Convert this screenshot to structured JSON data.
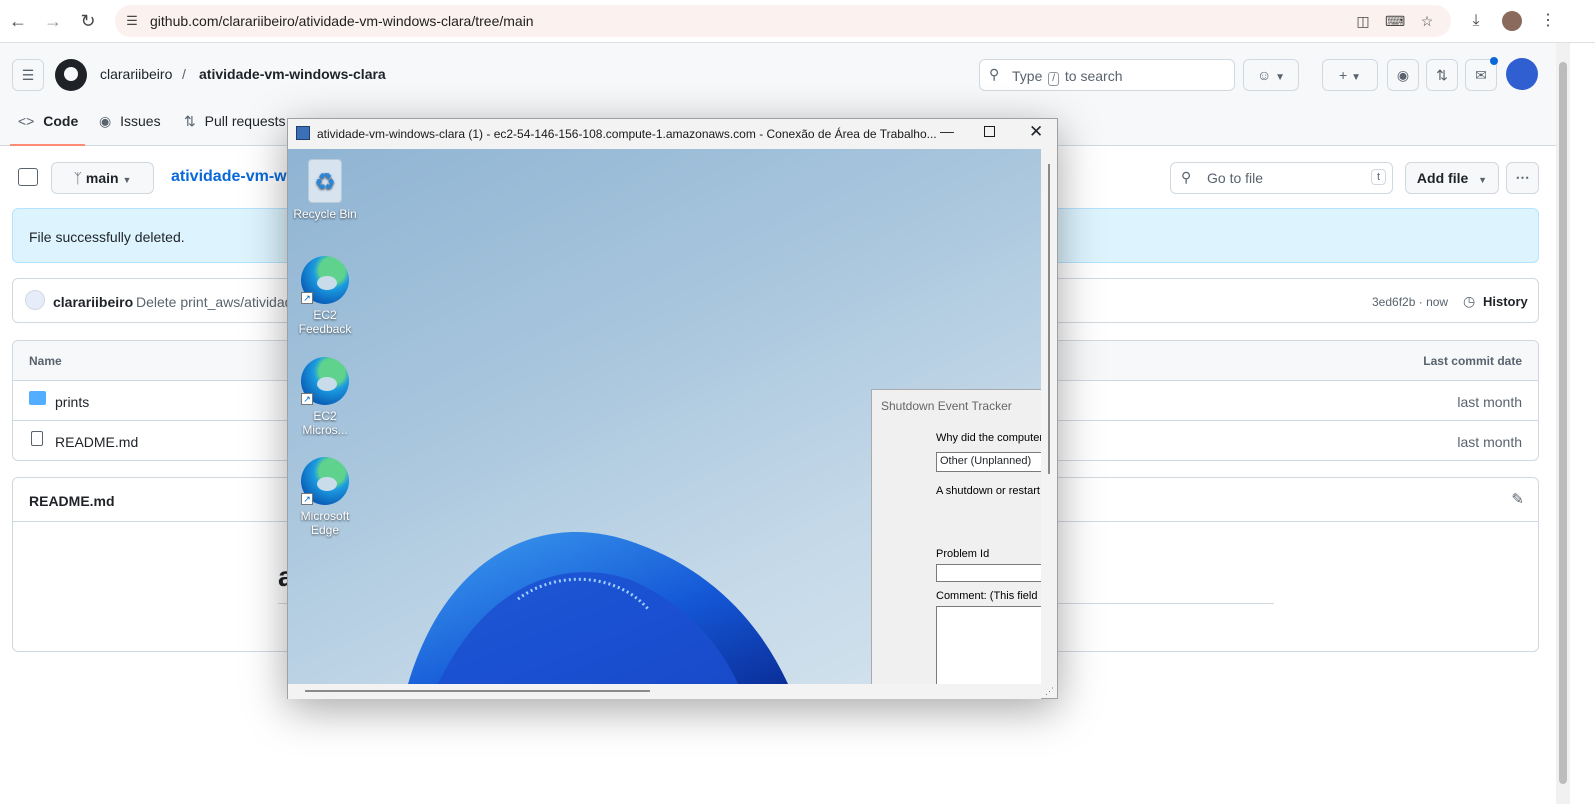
{
  "browser": {
    "url": "github.com/clarariibeiro/atividade-vm-windows-clara/tree/main",
    "icons": [
      "back-icon",
      "forward-icon",
      "reload-icon",
      "site-info-icon",
      "install-app-icon",
      "translate-icon",
      "bookmark-star-icon",
      "download-icon",
      "profile-avatar",
      "menu-kebab-icon"
    ]
  },
  "github": {
    "owner": "clarariibeiro",
    "separator": "/",
    "repo": "atividade-vm-windows-clara",
    "search": {
      "before": "Type",
      "key": "/",
      "after": "to search"
    },
    "tabs": [
      {
        "label": "Code"
      },
      {
        "label": "Issues"
      },
      {
        "label": "Pull requests"
      }
    ],
    "branch": "main",
    "breadcrumb_repo": "atividade-vm-wi",
    "goto_file": {
      "placeholder": "Go to file",
      "shortcut": "t"
    },
    "add_file": "Add file",
    "flash_message": "File successfully deleted.",
    "commit": {
      "author": "clarariibeiro",
      "message": "Delete print_aws/atividad",
      "sha": "3ed6f2b",
      "time": "now",
      "history_label": "History"
    },
    "table": {
      "col_name": "Name",
      "col_date": "Last commit date",
      "rows": [
        {
          "name": "prints",
          "type": "folder",
          "date": "last month"
        },
        {
          "name": "README.md",
          "type": "file",
          "date": "last month"
        }
      ]
    },
    "readme": {
      "title": "README.md",
      "heading_fragment": "a"
    }
  },
  "rdp": {
    "title": "atividade-vm-windows-clara (1) - ec2-54-146-156-108.compute-1.amazonaws.com - Conexão de Área de Trabalho...",
    "desktop_icons": [
      {
        "label": "Recycle Bin"
      },
      {
        "label": "EC2 Feedback"
      },
      {
        "label": "EC2 Micros..."
      },
      {
        "label": "Microsoft Edge"
      }
    ],
    "shutdown_tracker": {
      "title": "Shutdown Event Tracker",
      "question": "Why did the computer",
      "selected_reason": "Other (Unplanned)",
      "info": "A shutdown or restart",
      "problem_id_label": "Problem Id",
      "comment_label": "Comment: (This field is"
    }
  },
  "colors": {
    "accent_underline": "#fd8c73",
    "link_blue": "#0969da",
    "flash_bg": "#ddf4ff",
    "folder_blue": "#54aeff"
  }
}
